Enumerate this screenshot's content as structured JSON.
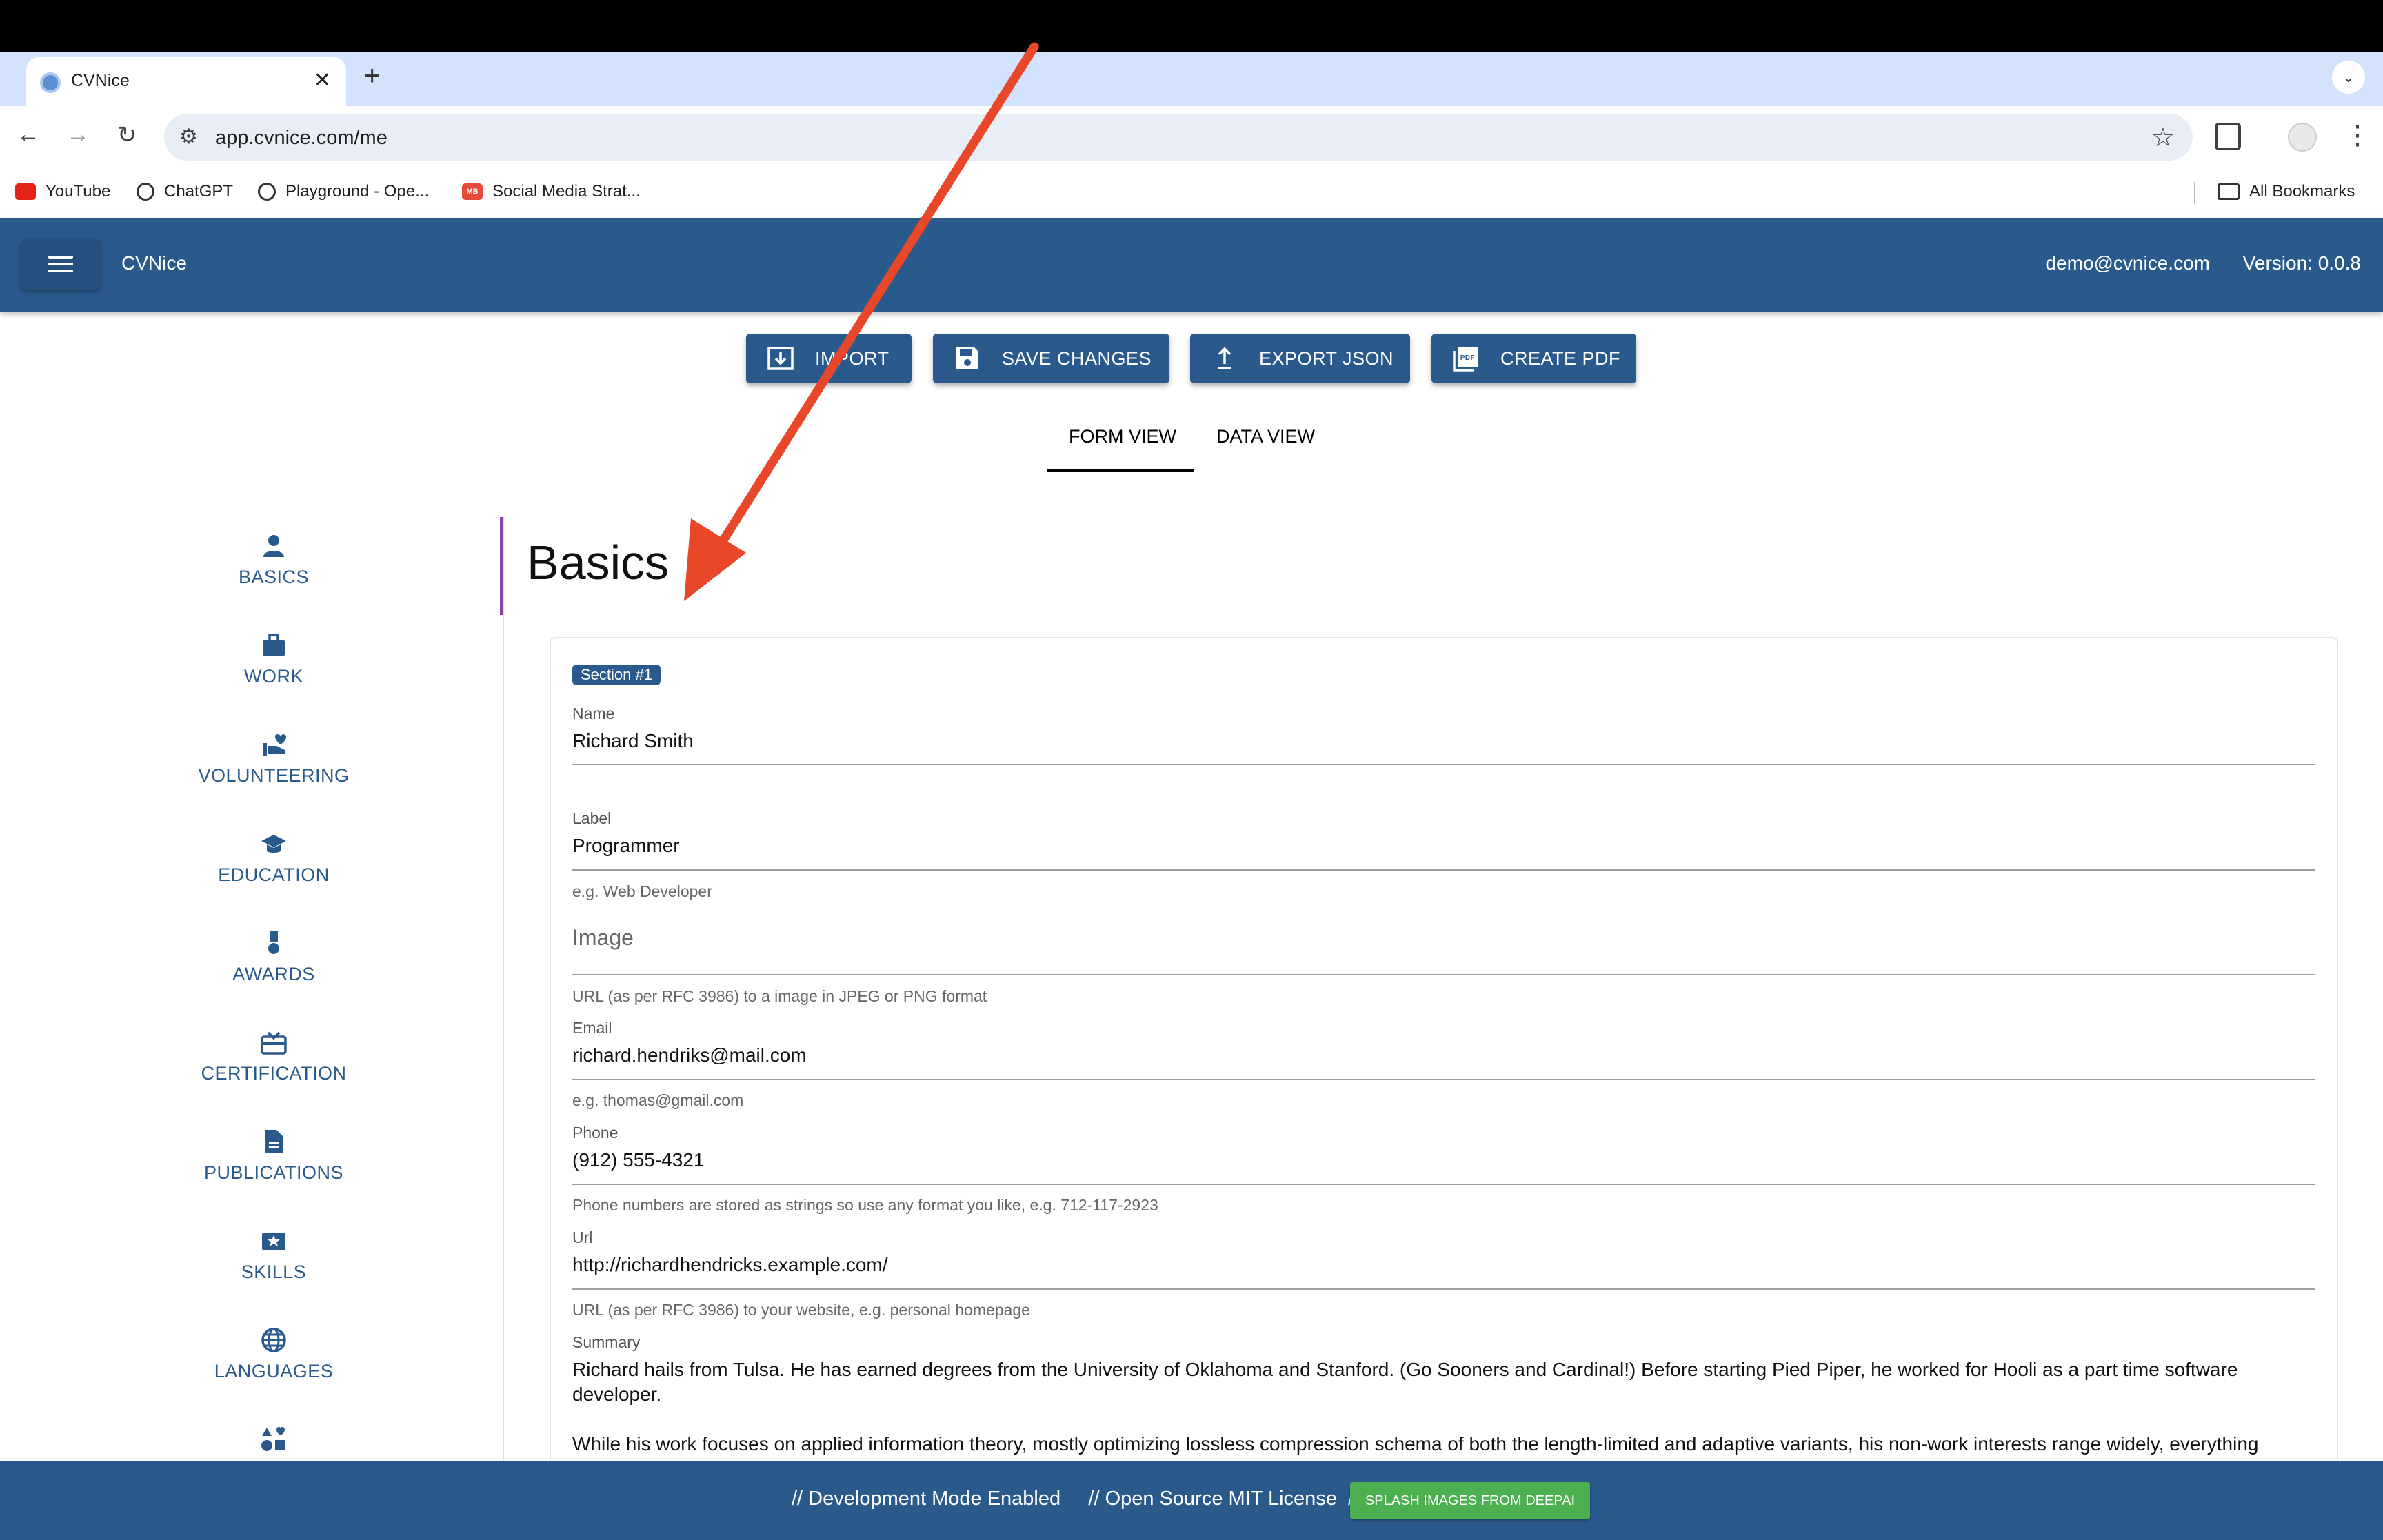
{
  "browser": {
    "tab_title": "CVNice",
    "url": "app.cvnice.com/me",
    "bookmarks": [
      "YouTube",
      "ChatGPT",
      "Playground - Ope...",
      "Social Media Strat..."
    ],
    "all_bookmarks": "All Bookmarks",
    "bookmark_badge": "MB"
  },
  "appbar": {
    "title": "CVNice",
    "email": "demo@cvnice.com",
    "version": "Version: 0.0.8"
  },
  "actions": {
    "import": "IMPORT",
    "save": "SAVE CHANGES",
    "export": "EXPORT JSON",
    "pdf": "CREATE PDF",
    "pdf_icon_text": "PDF"
  },
  "view_tabs": {
    "form": "FORM VIEW",
    "data": "DATA VIEW"
  },
  "sidebar": {
    "items": [
      "BASICS",
      "WORK",
      "VOLUNTEERING",
      "EDUCATION",
      "AWARDS",
      "CERTIFICATION",
      "PUBLICATIONS",
      "SKILLS",
      "LANGUAGES"
    ]
  },
  "form": {
    "section_title": "Basics",
    "chip": "Section #1",
    "name_label": "Name",
    "name_value": "Richard Smith",
    "label_label": "Label",
    "label_value": "Programmer",
    "label_hint": "e.g. Web Developer",
    "image_placeholder": "Image",
    "image_hint": "URL (as per RFC 3986) to a image in JPEG or PNG format",
    "email_label": "Email",
    "email_value": "richard.hendriks@mail.com",
    "email_hint": "e.g. thomas@gmail.com",
    "phone_label": "Phone",
    "phone_value": "(912) 555-4321",
    "phone_hint": "Phone numbers are stored as strings so use any format you like, e.g. 712-117-2923",
    "url_label": "Url",
    "url_value": "http://richardhendricks.example.com/",
    "url_hint": "URL (as per RFC 3986) to your website, e.g. personal homepage",
    "summary_label": "Summary",
    "summary_p1": "Richard hails from Tulsa. He has earned degrees from the University of Oklahoma and Stanford. (Go Sooners and Cardinal!) Before starting Pied Piper, he worked for Hooli as a part time software developer.",
    "summary_p2": "While his work focuses on applied information theory, mostly optimizing lossless compression schema of both the length-limited and adaptive variants, his non-work interests range widely, everything"
  },
  "footer": {
    "text": "// Development Mode Enabled     // Open Source MIT License  //",
    "button": "SPLASH IMAGES FROM DEEPAI"
  },
  "colors": {
    "primary": "#2a5a8c",
    "accent": "#8e44ad",
    "footer_button": "#4caf50",
    "arrow": "#e8472a"
  }
}
